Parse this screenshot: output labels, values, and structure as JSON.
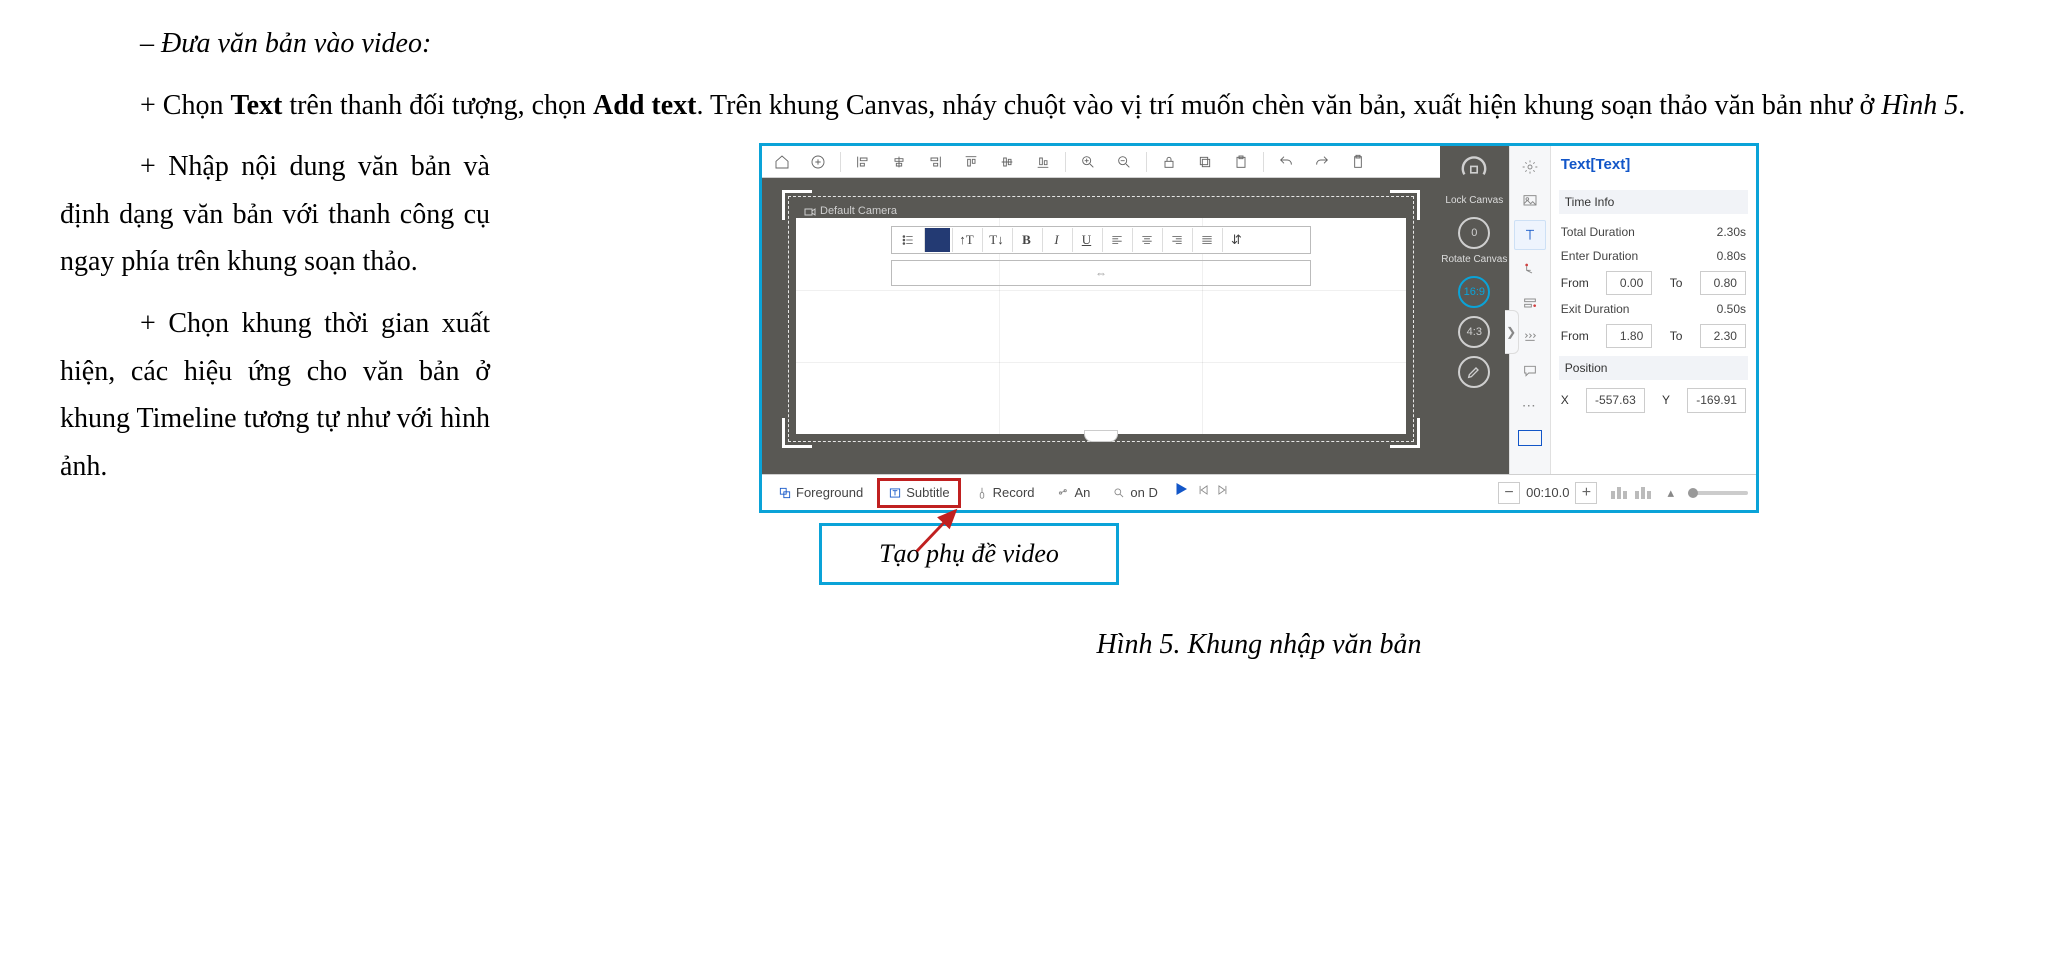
{
  "doc": {
    "line_heading": "– Đưa văn bản vào video:",
    "para1_pre": "+ Chọn ",
    "para1_b1": "Text",
    "para1_mid": " trên thanh đối tượng, chọn ",
    "para1_b2": "Add text",
    "para1_post": ". Trên khung Canvas, nháy chuột vào vị trí muốn chèn văn bản, xuất hiện khung soạn thảo văn bản như ở ",
    "para1_i": "Hình 5",
    "para1_end": ".",
    "left_p1": "+ Nhập nội dung văn bản và định dạng văn bản với thanh công cụ ngay phía trên khung soạn thảo.",
    "left_p2": "+ Chọn khung thời gian xuất hiện, các hiệu ứng cho văn bản ở khung Timeline tương tự như với hình ảnh.",
    "callout": "Tạo phụ đề video",
    "fig_caption": "Hình 5. Khung nhập văn bản"
  },
  "app": {
    "camera_label": "Default Camera",
    "right_tools": {
      "lock": "Lock Canvas",
      "rotate": "Rotate Canvas",
      "rotate_val": "0",
      "aspect_169": "16:9",
      "aspect_43": "4:3"
    },
    "tabs": {
      "foreground": "Foreground",
      "subtitle": "Subtitle",
      "record": "Record",
      "an": "An",
      "ond": "on D"
    },
    "time": "00:10.0",
    "props": {
      "title": "Text[Text]",
      "time_info": "Time Info",
      "total_dur_l": "Total Duration",
      "total_dur_v": "2.30s",
      "enter_dur_l": "Enter Duration",
      "enter_dur_v": "0.80s",
      "from_l": "From",
      "to_l": "To",
      "from1": "0.00",
      "to1": "0.80",
      "exit_dur_l": "Exit Duration",
      "exit_dur_v": "0.50s",
      "from2": "1.80",
      "to2": "2.30",
      "position": "Position",
      "x_l": "X",
      "x_v": "-557.63",
      "y_l": "Y",
      "y_v": "-169.91"
    },
    "textbar": {
      "updown": "⇵",
      "bullet": "☰",
      "tup": "↑T",
      "tdown": "T↓",
      "b": "B",
      "i": "I",
      "u": "U",
      "move": "⇔"
    }
  }
}
